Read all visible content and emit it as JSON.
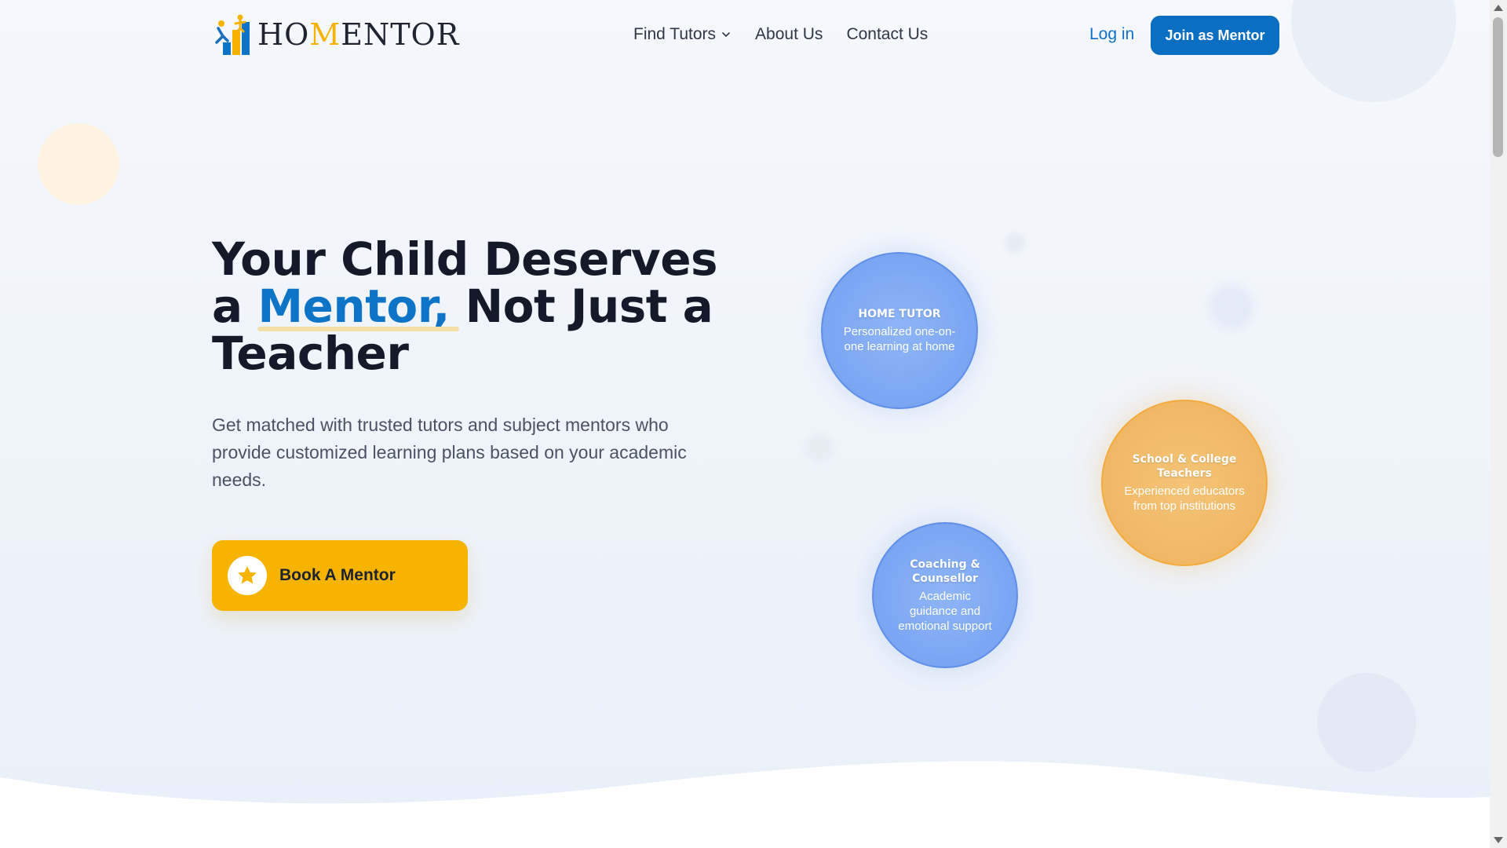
{
  "brand": {
    "name_part1": "HO",
    "name_accent": "M",
    "name_part2": "ENTOR",
    "logo_icon": "mentor-climbing-logo-icon"
  },
  "nav": {
    "items": [
      {
        "label": "Find Tutors",
        "has_dropdown": true
      },
      {
        "label": "About Us"
      },
      {
        "label": "Contact Us"
      }
    ],
    "login_label": "Log in",
    "join_label": "Join as Mentor"
  },
  "hero": {
    "title_line1": "Your Child Deserves",
    "title_a": "a ",
    "title_accent": "Mentor,",
    "title_rest": " Not Just a",
    "title_line3": "Teacher",
    "subtitle": "Get matched with trusted tutors and subject mentors who provide customized learning plans based on your academic needs.",
    "cta_label": "Book A Mentor",
    "cta_icon": "star-icon"
  },
  "services": [
    {
      "title": "HOME TUTOR",
      "desc": "Personalized one-on-one learning at home",
      "color": "#7aa5f2"
    },
    {
      "title": "School & College Teachers",
      "desc": "Experienced educators from top institutions",
      "color": "#f0b865"
    },
    {
      "title": "Coaching & Counsellor",
      "desc": "Academic guidance and emotional support",
      "color": "#7aa5f2"
    }
  ],
  "colors": {
    "primary": "#0a6ec2",
    "accent_yellow": "#f6b400",
    "text_dark": "#141a2a"
  }
}
